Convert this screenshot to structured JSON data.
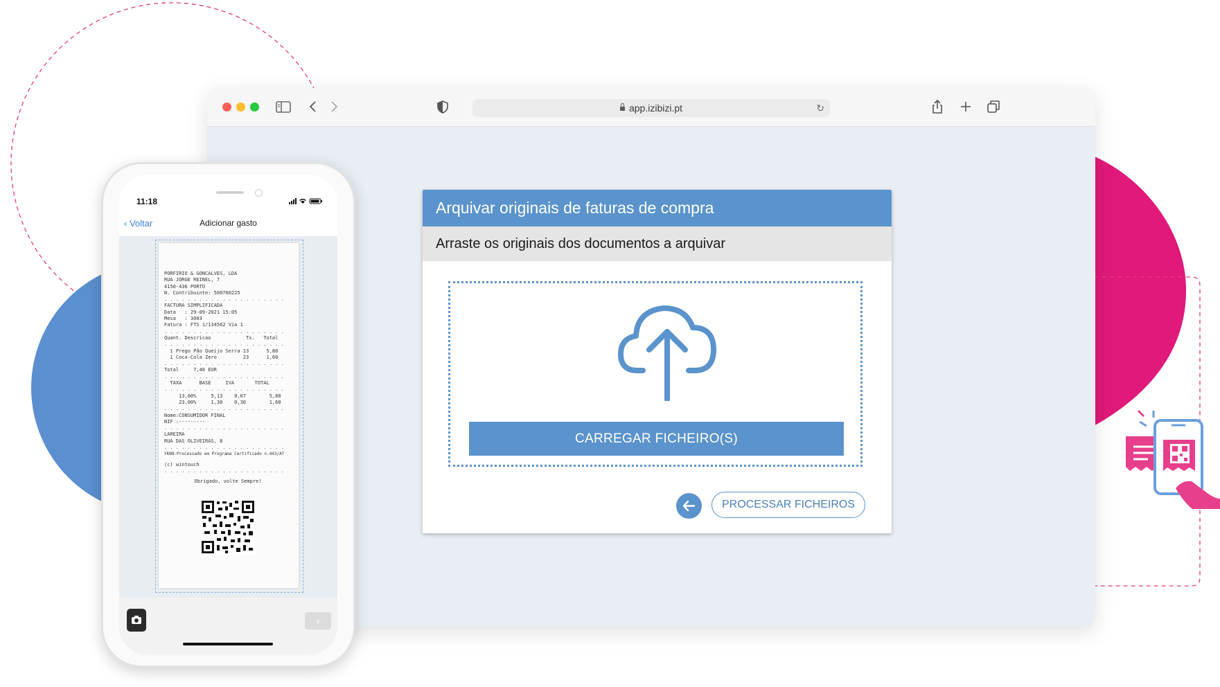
{
  "browser": {
    "url": "app.izibizi.pt",
    "traffic_lights": {
      "close": "#ff5f57",
      "minimize": "#febc2e",
      "zoom": "#28c840"
    },
    "toolbar_icons": [
      "sidebar-icon",
      "back-icon",
      "forward-icon",
      "shield-icon",
      "share-icon",
      "new-tab-icon",
      "tabs-overview-icon"
    ]
  },
  "dialog": {
    "title": "Arquivar originais de faturas de compra",
    "subtitle": "Arraste os originais dos documentos a arquivar",
    "upload_label": "CARREGAR FICHEIRO(S)",
    "process_label": "PROCESSAR FICHEIROS",
    "accent": "#5b93cc"
  },
  "phone": {
    "time": "11:18",
    "back_label": "Voltar",
    "title": "Adicionar gasto",
    "receipt": {
      "header": [
        "PORFIRIO & GONCALVES, LDA",
        "RUA JORGE REINEL, 7",
        "4150-436 PORTO",
        "N. Contribuinte: 500760225"
      ],
      "doc": [
        "FACTURA SIMPLIFICADA",
        "Data   : 29-09-2021 15:05",
        "Mesa   : 3003",
        "Fatura : FTS 1/134562 Via 1"
      ],
      "columns": "Quant. Descricao            Tx.   Total",
      "items": [
        "  1 Prego Pão Queijo Serra 13      5,80",
        "  1 Coca-Cola Zero         23      1,60"
      ],
      "total": "Total     7,40 EUR",
      "tax_header": "  TAXA      BASE     IVA       TOTAL",
      "tax_rows": [
        "     13,00%     5,13    0,67        5,80",
        "     23,00%     1,30    0,30        1,60"
      ],
      "customer": [
        "Nome:CONSUMIDOR FINAL",
        "NIF :---------"
      ],
      "place": [
        "LAREIRA",
        "RUA DAS OLIVEIRAS, 8"
      ],
      "cert": "YKN8-Processado em Programa Certificado n.443/AT",
      "copyright": "(c) wintouch",
      "thanks": "Obrigado, volte Sempre!"
    }
  }
}
